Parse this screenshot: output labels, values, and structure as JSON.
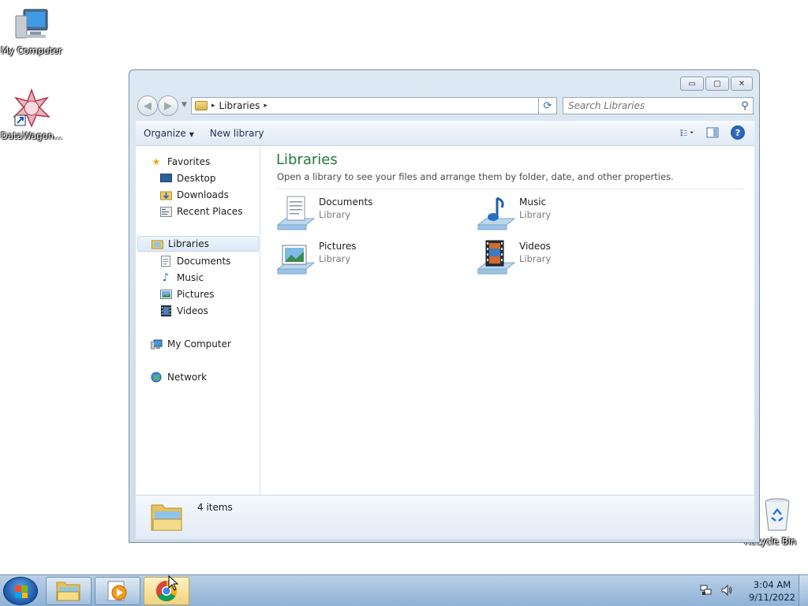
{
  "desktop": {
    "icons": [
      {
        "label": "My Computer",
        "icon": "computer-icon"
      },
      {
        "label": "DataWagon...",
        "icon": "datawagon-icon"
      },
      {
        "label": "Recycle Bin",
        "icon": "recycle-bin-icon"
      }
    ]
  },
  "window": {
    "caption_buttons": {
      "minimize": "▭",
      "maximize": "▢",
      "close": "✕"
    },
    "address": {
      "location": "Libraries",
      "separator": "▸"
    },
    "search": {
      "placeholder": "Search Libraries"
    },
    "toolbar": {
      "organize": "Organize",
      "new_library": "New library"
    },
    "navpane": {
      "favorites": {
        "label": "Favorites",
        "items": [
          "Desktop",
          "Downloads",
          "Recent Places"
        ]
      },
      "libraries": {
        "label": "Libraries",
        "items": [
          "Documents",
          "Music",
          "Pictures",
          "Videos"
        ]
      },
      "computer": "My Computer",
      "network": "Network"
    },
    "content": {
      "title": "Libraries",
      "subtitle": "Open a library to see your files and arrange them by folder, date, and other properties.",
      "libraries": [
        {
          "name": "Documents",
          "type": "Library",
          "icon": "documents-library-icon"
        },
        {
          "name": "Music",
          "type": "Library",
          "icon": "music-library-icon"
        },
        {
          "name": "Pictures",
          "type": "Library",
          "icon": "pictures-library-icon"
        },
        {
          "name": "Videos",
          "type": "Library",
          "icon": "videos-library-icon"
        }
      ]
    },
    "status": {
      "count": "4 items"
    }
  },
  "taskbar": {
    "buttons": [
      {
        "name": "explorer",
        "icon": "folder-icon"
      },
      {
        "name": "media-player",
        "icon": "media-player-icon"
      },
      {
        "name": "chrome",
        "icon": "chrome-icon",
        "active": true
      }
    ],
    "clock": {
      "time": "3:04 AM",
      "date": "9/11/2022"
    }
  },
  "colors": {
    "title_green": "#1e7a3d",
    "taskbar": "#8fb2d6",
    "window_frame": "#dde8f3"
  }
}
